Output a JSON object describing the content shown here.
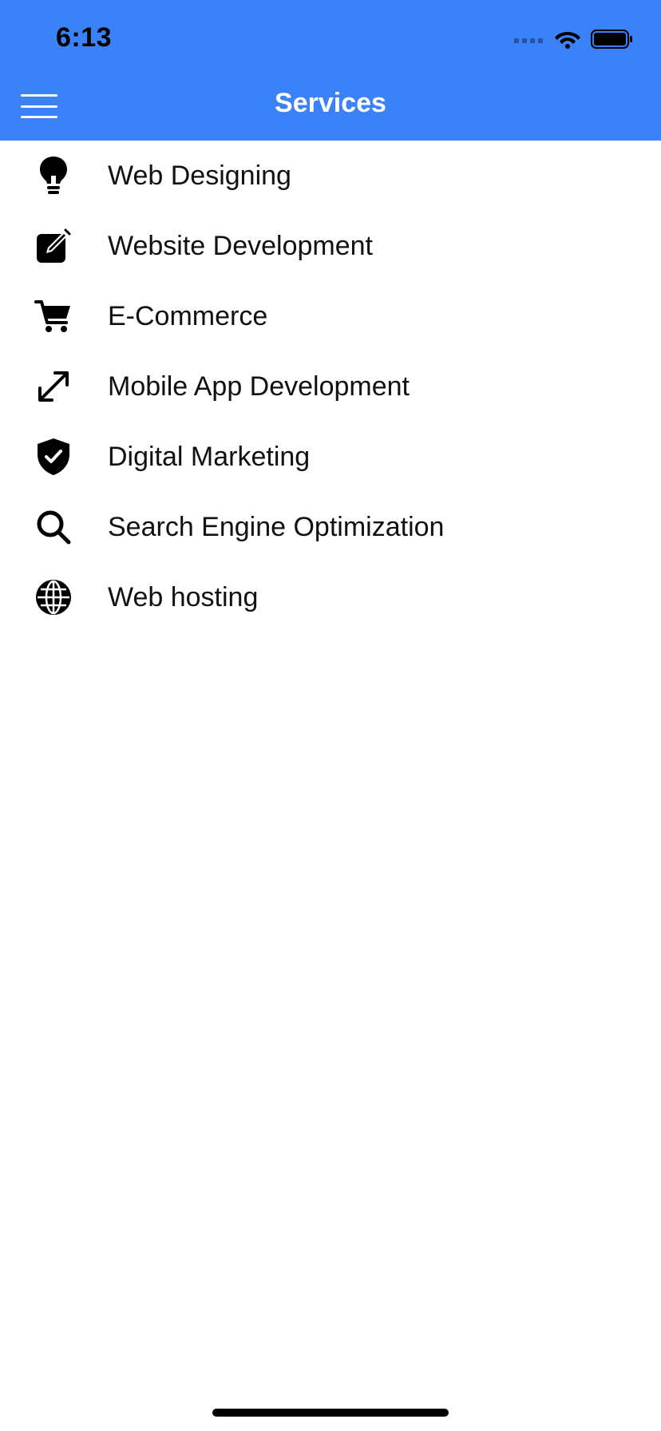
{
  "status_bar": {
    "time": "6:13"
  },
  "header": {
    "title": "Services",
    "background_color": "#3b82f8",
    "title_color": "#ffffff"
  },
  "menu": {
    "items": [
      {
        "label": "Web Designing",
        "icon": "lightbulb-icon"
      },
      {
        "label": "Website Development",
        "icon": "edit-square-icon"
      },
      {
        "label": "E-Commerce",
        "icon": "shopping-cart-icon"
      },
      {
        "label": "Mobile App Development",
        "icon": "resize-diagonal-icon"
      },
      {
        "label": "Digital Marketing",
        "icon": "shield-check-icon"
      },
      {
        "label": "Search Engine Optimization",
        "icon": "search-icon"
      },
      {
        "label": "Web hosting",
        "icon": "globe-icon"
      }
    ]
  }
}
